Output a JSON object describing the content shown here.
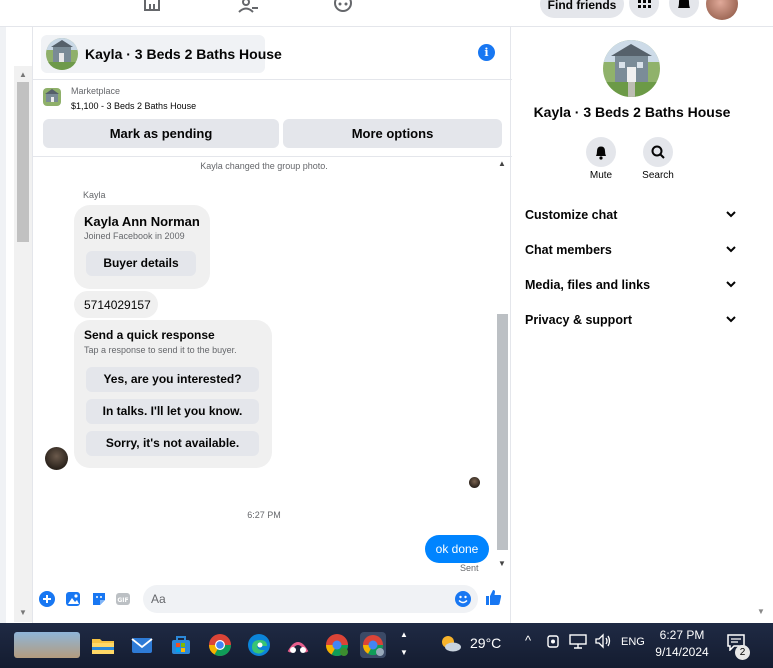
{
  "topnav": {
    "find_friends_label": "Find friends"
  },
  "chat": {
    "title": "Kayla · 3 Beds 2 Baths House",
    "marketplace_label": "Marketplace",
    "listing_price": "$1,100 - 3 Beds 2 Baths House",
    "mark_pending_label": "Mark as pending",
    "more_options_label": "More options",
    "system_note": "Kayla changed the group photo.",
    "sender_name": "Kayla",
    "card": {
      "name": "Kayla Ann Norman",
      "subtitle": "Joined Facebook in 2009",
      "button": "Buyer details"
    },
    "phone_message": "5714029157",
    "quick_response": {
      "title": "Send a quick response",
      "subtitle": "Tap a response to send it to the buyer.",
      "options": [
        "Yes, are you interested?",
        "In talks. I'll let you know.",
        "Sorry, it's not available."
      ]
    },
    "timestamp": "6:27 PM",
    "sent_message": "ok done",
    "sent_status": "Sent",
    "composer_placeholder": "Aa",
    "accent_color": "#0084ff"
  },
  "right_panel": {
    "title": "Kayla · 3 Beds 2 Baths House",
    "actions": [
      {
        "label": "Mute",
        "icon": "bell-icon"
      },
      {
        "label": "Search",
        "icon": "search-icon"
      }
    ],
    "sections": [
      "Customize chat",
      "Chat members",
      "Media, files and links",
      "Privacy & support"
    ]
  },
  "taskbar": {
    "temperature": "29°C",
    "language": "ENG",
    "time": "6:27 PM",
    "date": "9/14/2024",
    "notification_count": "2"
  }
}
